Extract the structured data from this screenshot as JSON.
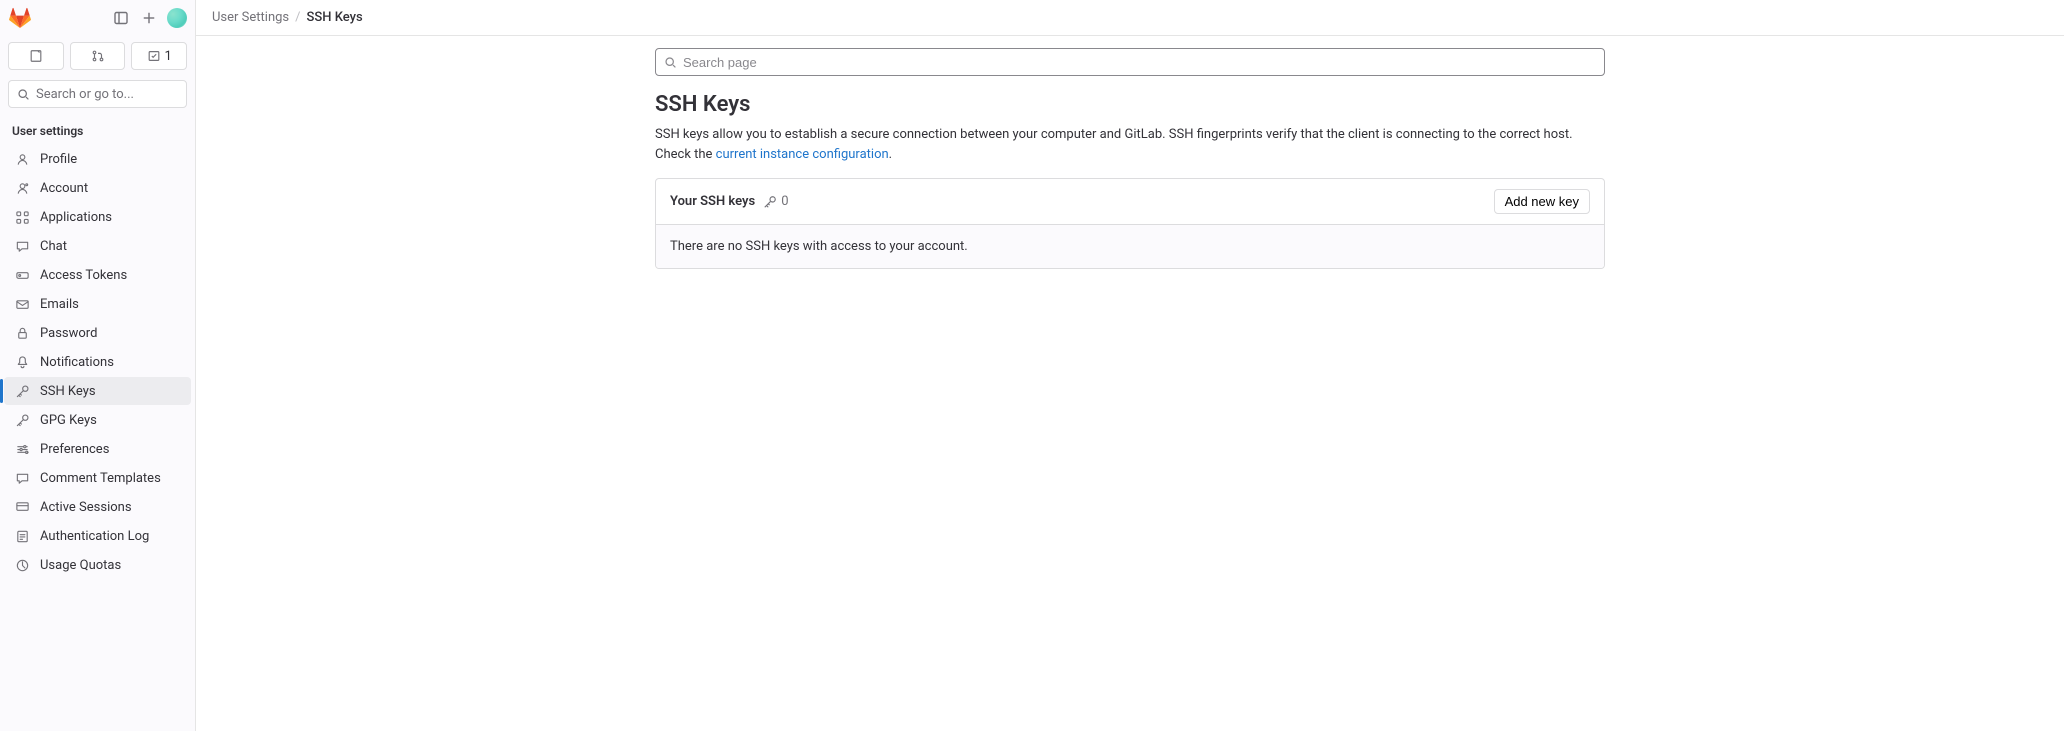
{
  "sidebar": {
    "search_placeholder": "Search or go to...",
    "section_title": "User settings",
    "mr_count": "1",
    "items": [
      {
        "label": "Profile",
        "icon": "user"
      },
      {
        "label": "Account",
        "icon": "account"
      },
      {
        "label": "Applications",
        "icon": "apps"
      },
      {
        "label": "Chat",
        "icon": "chat"
      },
      {
        "label": "Access Tokens",
        "icon": "token"
      },
      {
        "label": "Emails",
        "icon": "email"
      },
      {
        "label": "Password",
        "icon": "lock"
      },
      {
        "label": "Notifications",
        "icon": "bell"
      },
      {
        "label": "SSH Keys",
        "icon": "key",
        "active": true
      },
      {
        "label": "GPG Keys",
        "icon": "key"
      },
      {
        "label": "Preferences",
        "icon": "prefs"
      },
      {
        "label": "Comment Templates",
        "icon": "comment"
      },
      {
        "label": "Active Sessions",
        "icon": "sessions"
      },
      {
        "label": "Authentication Log",
        "icon": "log"
      },
      {
        "label": "Usage Quotas",
        "icon": "quota"
      }
    ]
  },
  "breadcrumb": {
    "parent": "User Settings",
    "current": "SSH Keys"
  },
  "page": {
    "search_placeholder": "Search page",
    "title": "SSH Keys",
    "desc_before_link": "SSH keys allow you to establish a secure connection between your computer and GitLab. SSH fingerprints verify that the client is connecting to the correct host. Check the ",
    "desc_link": "current instance configuration",
    "desc_after_link": ".",
    "card_title": "Your SSH keys",
    "key_count": "0",
    "add_button": "Add new key",
    "empty_message": "There are no SSH keys with access to your account."
  }
}
